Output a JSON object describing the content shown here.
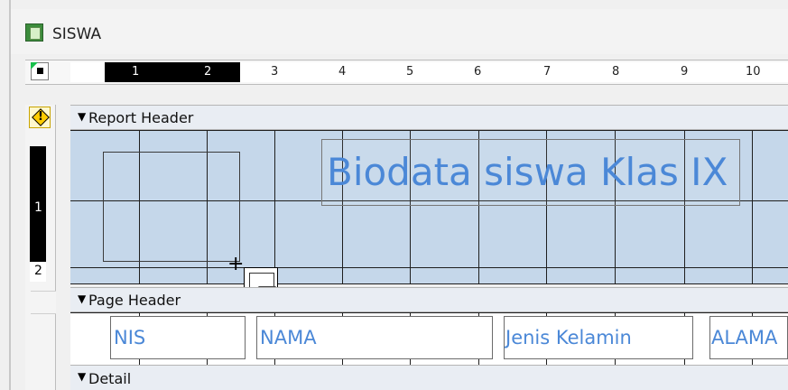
{
  "window": {
    "title": "SISWA",
    "icon": "report-icon"
  },
  "ruler": {
    "top_labels": [
      "1",
      "2",
      "3",
      "4",
      "5",
      "6",
      "7",
      "8",
      "9",
      "10"
    ],
    "left_labels": [
      "1",
      "2"
    ]
  },
  "sections": {
    "report_header": "Report Header",
    "page_header": "Page Header",
    "detail": "Detail"
  },
  "report_header": {
    "title": "Biodata siswa Klas IX",
    "controls": {
      "image_control": "image-icon",
      "cursor": "crosshair-icon"
    }
  },
  "page_header": {
    "fields": [
      "NIS",
      "NAMA",
      "Jenis Kelamin",
      "ALAMA"
    ]
  },
  "icons": {
    "warning": "warning-icon",
    "section_arrow": "arrow-icon"
  }
}
